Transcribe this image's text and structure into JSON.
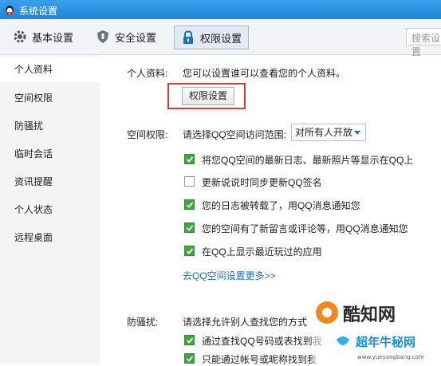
{
  "window": {
    "title": "系统设置"
  },
  "toolbar": {
    "basic": "基本设置",
    "security": "安全设置",
    "permission": "权限设置",
    "search_placeholder": "搜索设置"
  },
  "sidebar": {
    "items": [
      {
        "label": "个人资料",
        "active": true
      },
      {
        "label": "空间权限"
      },
      {
        "label": "防骚扰"
      },
      {
        "label": "临时会话"
      },
      {
        "label": "资讯提醒"
      },
      {
        "label": "个人状态"
      },
      {
        "label": "远程桌面"
      }
    ]
  },
  "profile": {
    "label": "个人资料:",
    "desc": "您可以设置谁可以查看您的个人资料。",
    "button": "权限设置"
  },
  "space": {
    "label": "空间权限:",
    "prompt": "请选择QQ空间访问范围:",
    "selected": "对所有人开放",
    "options": [
      {
        "label": "将您QQ空间的最新日志、最新照片等显示在QQ上",
        "checked": true
      },
      {
        "label": "更新说说时同步更新QQ签名",
        "checked": false
      },
      {
        "label": "您的日志被转载了，用QQ消息通知您",
        "checked": true
      },
      {
        "label": "您的空间有了新留言或评论等，用QQ消息通知您",
        "checked": true
      },
      {
        "label": "在QQ上显示最近玩过的应用",
        "checked": true
      }
    ],
    "more_link": "去QQ空间设置更多>>"
  },
  "harass": {
    "label": "防骚扰:",
    "prompt": "请选择允许别人查找您的方式",
    "options": [
      {
        "label": "通过查找QQ号码或表找到我",
        "checked": true
      },
      {
        "label": "只能通过帐号或昵称找到我",
        "checked": true
      }
    ]
  },
  "watermark": {
    "brand": "酷知网",
    "sub": "超年牛秘网",
    "url": "www.yueyangbang.com"
  },
  "colors": {
    "titlebar": "#1f86d8",
    "check": "#3ea63e",
    "highlight": "#d9383c",
    "link": "#1d6fc7"
  }
}
